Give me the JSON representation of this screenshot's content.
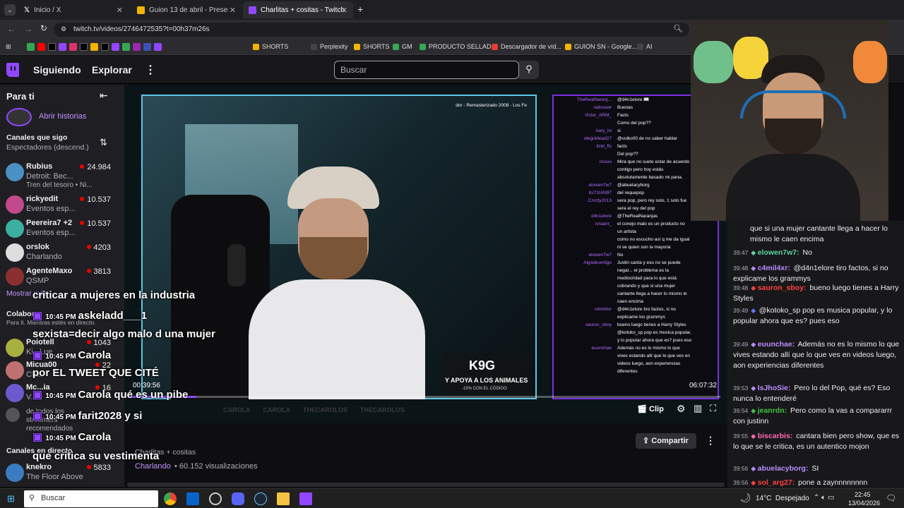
{
  "browser": {
    "tabs": [
      {
        "title": "Inicio / X"
      },
      {
        "title": "Guion 13 de abril - Presentación"
      },
      {
        "title": "Charlitas + cositas - Twitch"
      }
    ],
    "url": "twitch.tv/videos/2746472535?t=00h37m26s",
    "bookmarks": [
      "SHORTS",
      "Perplexity",
      "SHORTS",
      "GM",
      "PRODUCTO SELLAD...",
      "Descargador de víd...",
      "GUION SN - Google...",
      "AI"
    ]
  },
  "nav": {
    "following": "Siguiendo",
    "explore": "Explorar",
    "more": "⋮",
    "search_placeholder": "Buscar"
  },
  "sidebar": {
    "for_you": "Para ti",
    "stories": "Abrir historias",
    "followed_title": "Canales que sigo",
    "sort_label": "Espectadores (descend.)",
    "channels": [
      {
        "name": "Rubius",
        "game": "Detroit: Bec...",
        "sub": "Tren del tesoro • Ni...",
        "viewers": "24.984"
      },
      {
        "name": "rickyedit",
        "game": "Eventos esp...",
        "viewers": "10.537"
      },
      {
        "name": "Peereira7 +2",
        "game": "Eventos esp...",
        "viewers": "10.537"
      },
      {
        "name": "orslok",
        "game": "Charlando",
        "viewers": "4203"
      },
      {
        "name": "AgenteMaxo",
        "game": "QSMP",
        "viewers": "3813"
      }
    ],
    "show_more": "Mostrar más",
    "collab_title": "Colabor",
    "collab_sub": "Para ti. Mientras estés en directo.",
    "collab_channels": [
      {
        "name": "Poiotell",
        "game": "Ki...Lue",
        "viewers": "1043"
      },
      {
        "name": "Micua00",
        "game": "Ch...",
        "viewers": "22"
      },
      {
        "name": "Mc...ia",
        "game": "V...",
        "viewers": "16"
      },
      {
        "name": "",
        "game": "de todos los streamers recomendados",
        "viewers": ""
      }
    ],
    "live_title": "Canales en directo",
    "live_channels": [
      {
        "name": "knekro",
        "game": "The Floor Above",
        "viewers": "5833"
      }
    ]
  },
  "player": {
    "overlay_song": "dor - Remasterizado 2008 - Los Fe",
    "time_left": "00:39:56",
    "time_right": "06:07:32",
    "clip_label": "Clip",
    "socials": [
      "CAROLA",
      "CAROLA",
      "THECAROLOS",
      "THECAROLOS"
    ],
    "sponsor": "Y APOYA A LOS ANIMALES",
    "sponsor_sub": "-15% CON EL CÓDIGO"
  },
  "embedded_chat": [
    {
      "user": "TheRealNaranj...",
      "msg": "@d4n1elore 📖"
    },
    {
      "user": "natssswr",
      "msg": ""
    },
    {
      "user": "",
      "msg": "Buenas"
    },
    {
      "user": "Victor_ARM_",
      "msg": "Facts"
    },
    {
      "user": "",
      "msg": "Como del pop??"
    },
    {
      "user": "kary_ivi",
      "msg": "si"
    },
    {
      "user": "diegoldead27",
      "msg": "@vulko00 de no saber hablar"
    },
    {
      "user": "itzel_fls",
      "msg": "facts"
    },
    {
      "user": "",
      "msg": "Del pop??"
    },
    {
      "user": "risxuu",
      "msg": "Mira que no suelo estar de acuerdo"
    },
    {
      "user": "",
      "msg": "contigo pero hoy estás"
    },
    {
      "user": "",
      "msg": "absolutamente basado mi pana."
    },
    {
      "user": "",
      "msg": ""
    },
    {
      "user": "elowen7w7",
      "msg": "@abuelacyborg"
    },
    {
      "user": "ItsT1tAN97",
      "msg": "del requepop"
    },
    {
      "user": "Crozty2013",
      "msg": "sera pop, pero rey solo, 1 solo fue"
    },
    {
      "user": "",
      "msg": "sera el rey del pop"
    },
    {
      "user": "d4n1elore",
      "msg": "@TheRealNaranjas"
    },
    {
      "user": "ivraant_",
      "msg": "el conejo malo es un producto no"
    },
    {
      "user": "",
      "msg": "un artista"
    },
    {
      "user": "",
      "msg": "como no escucho así q me da igual"
    },
    {
      "user": "",
      "msg": "ni se quien son la mayoria"
    },
    {
      "user": "elowen7w7",
      "msg": "No"
    },
    {
      "user": "Algodevertigo",
      "msg": "Justin canta y eso no se puede"
    },
    {
      "user": "",
      "msg": "negar... el problema es la"
    },
    {
      "user": "",
      "msg": "mediocridad para lo que está"
    },
    {
      "user": "",
      "msg": "cobrando y que si una mujer"
    },
    {
      "user": "",
      "msg": "cantante llega a hacer lo mismo le"
    },
    {
      "user": "",
      "msg": "caen encima"
    },
    {
      "user": "c4mil4xr",
      "msg": "@d4n1elore tiro factos, si no"
    },
    {
      "user": "",
      "msg": "explicame los grammys"
    },
    {
      "user": "sauron_sboy",
      "msg": "bueno luego tienes a Harry Styles"
    },
    {
      "user": "",
      "msg": "@kotoko_sp pop es musica popular,"
    },
    {
      "user": "",
      "msg": "y lo popular ahora que es? pues eso"
    },
    {
      "user": "euunchae",
      "msg": "Además no es lo mismo lo que"
    },
    {
      "user": "",
      "msg": "vives estando allí que lo que ves en"
    },
    {
      "user": "",
      "msg": "videos luego, aon experiencias"
    },
    {
      "user": "",
      "msg": "diferentes"
    }
  ],
  "chat": {
    "top_partial": "que si una mujer cantante llega a hacer lo mismo le caen encima",
    "messages": [
      {
        "time": "39:47",
        "user": "elowen7w7",
        "color": "#5cd6a3",
        "text": "No"
      },
      {
        "time": "39:48",
        "user": "c4mil4xr",
        "color": "#b98cff",
        "text": "@d4n1elore tiro factos, si no explicame los grammys"
      },
      {
        "time": "39:48",
        "user": "sauron_sboy",
        "color": "#ff4040",
        "text": "bueno luego tienes a Harry Styles"
      },
      {
        "time": "39:49",
        "user": "",
        "color": "#5b7cff",
        "text": "@kotoko_sp pop es musica popular, y lo popular ahora que es? pues eso"
      },
      {
        "time": "39:49",
        "user": "euunchae",
        "color": "#b98cff",
        "text": "Además no es lo mismo lo que vives estando allí que lo que ves en videos luego, aon experiencias diferentes"
      },
      {
        "time": "39:53",
        "user": "IsJhoSie",
        "color": "#b98cff",
        "text": "Pero lo del Pop, qué es? Eso nunca lo entenderé"
      },
      {
        "time": "39:54",
        "user": "jeanrdn",
        "color": "#41c341",
        "text": "Pero como la vas a compararrr con justinn"
      },
      {
        "time": "39:55",
        "user": "biscarbis",
        "color": "#ff69b4",
        "text": "cantara bien pero show, que es lo que se le critica, es un autentico mojon"
      },
      {
        "time": "39:56",
        "user": "abuelacyborg",
        "color": "#b98cff",
        "text": "SI"
      },
      {
        "time": "39:56",
        "user": "sol_arg27",
        "color": "#ff4040",
        "text": "pone a zaynnnnnnnn"
      }
    ]
  },
  "info": {
    "title": "Charlitas + cositas",
    "category": "Charlando",
    "views": "• 60.152 visualizaciones",
    "share": "Compartir"
  },
  "overlay_chat": [
    {
      "time": "",
      "user": "",
      "text": "criticar a mujeres en la industria"
    },
    {
      "time": "10:45 PM",
      "user": "askeladd___1",
      "text": ""
    },
    {
      "time": "",
      "user": "",
      "text": "sexista=decir algo malo d una mujer"
    },
    {
      "time": "10:45 PM",
      "user": "Carola",
      "text": ""
    },
    {
      "time": "",
      "user": "",
      "text": "por EL TWEET QUE CITÉ"
    },
    {
      "time": "10:45 PM",
      "user": "Carola",
      "text": "qué es un pibe"
    },
    {
      "time": "10:45 PM",
      "user": "farit2028",
      "text": "y si"
    },
    {
      "time": "10:45 PM",
      "user": "Carola",
      "text": ""
    },
    {
      "time": "",
      "user": "",
      "text": "que critica su vestimenta"
    }
  ],
  "taskbar": {
    "search": "Buscar",
    "weather": "14°C  Despejado",
    "time": "22:45",
    "date": "13/04/2026"
  },
  "colors": {
    "twitch": "#9147ff",
    "live": "#eb0400"
  }
}
